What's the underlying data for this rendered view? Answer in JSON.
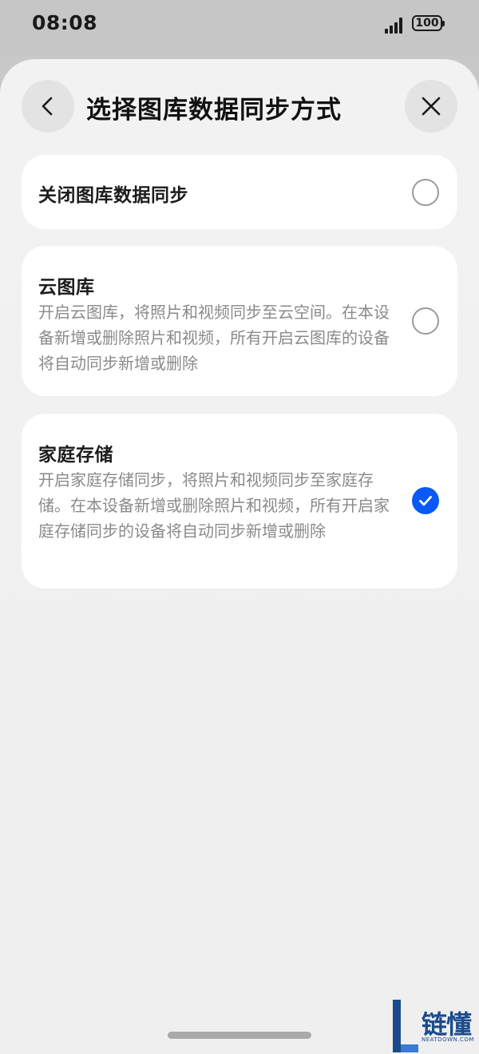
{
  "status_bar": {
    "time": "08:08",
    "battery": "100",
    "icons": [
      "signal-icon",
      "battery-icon"
    ]
  },
  "sheet": {
    "title": "选择图库数据同步方式",
    "back_icon": "chevron-left-icon",
    "close_icon": "close-icon"
  },
  "options": [
    {
      "title": "关闭图库数据同步",
      "description": "",
      "selected": false
    },
    {
      "title": "云图库",
      "description": "开启云图库，将照片和视频同步至云空间。在本设备新增或删除照片和视频，所有开启云图库的设备将自动同步新增或删除",
      "selected": false
    },
    {
      "title": "家庭存储",
      "description": "开启家庭存储同步，将照片和视频同步至家庭存储。在本设备新增或删除照片和视频，所有开启家庭存储同步的设备将自动同步新增或删除",
      "selected": true
    }
  ],
  "watermark": {
    "text": "链懂",
    "sub": "NEATDOWN.COM"
  },
  "colors": {
    "accent": "#0a59f7",
    "background": "#f1f1f1",
    "card": "#ffffff",
    "status_bar": "#c6c6c6"
  }
}
